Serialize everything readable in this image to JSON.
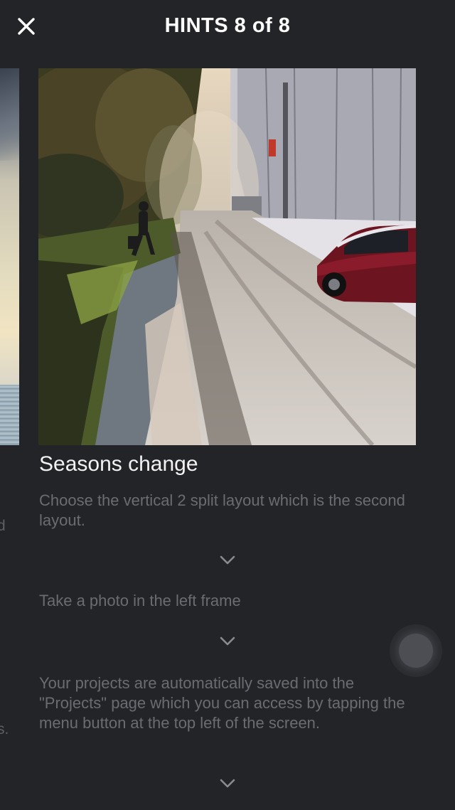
{
  "header": {
    "title": "HINTS 8 of 8",
    "close_icon": "close-icon"
  },
  "carousel": {
    "peek_left_fragment_1": "d",
    "peek_left_fragment_2": "s."
  },
  "hint": {
    "heading": "Seasons change",
    "steps": [
      "Choose the vertical 2 split layout which is the second layout.",
      "Take a photo in the left frame",
      "Your projects are automatically saved into the \"Projects\" page which you can access by tapping the menu button at the top left of the screen."
    ],
    "chevron_icon": "chevron-down-icon"
  },
  "colors": {
    "background": "#232428",
    "title": "#ffffff",
    "heading": "#f2f2f2",
    "step_text": "#6b6c71"
  }
}
